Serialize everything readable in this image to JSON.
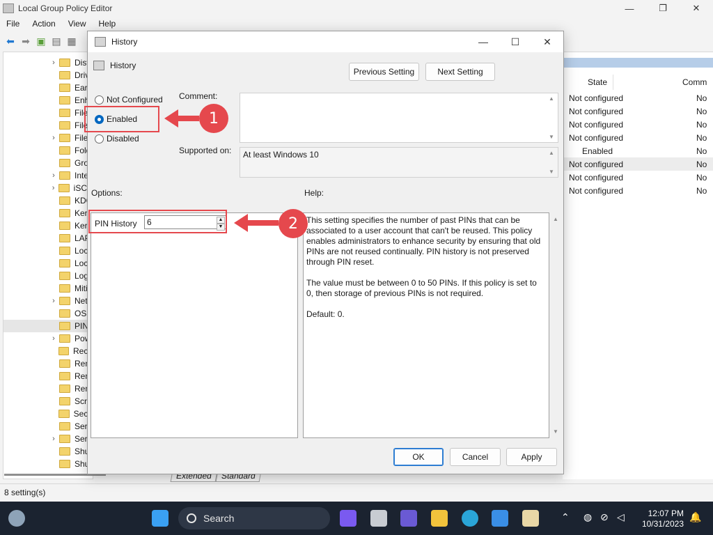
{
  "app": {
    "title": "Local Group Policy Editor",
    "window_controls": [
      "—",
      "❐",
      "✕"
    ],
    "menu": [
      "File",
      "Action",
      "View",
      "Help"
    ]
  },
  "tree": {
    "items": [
      {
        "label": "Dist",
        "expandable": true
      },
      {
        "label": "Driv",
        "expandable": false
      },
      {
        "label": "Earl",
        "expandable": false
      },
      {
        "label": "Enh",
        "expandable": false
      },
      {
        "label": "File",
        "expandable": false
      },
      {
        "label": "File",
        "expandable": false
      },
      {
        "label": "File",
        "expandable": true
      },
      {
        "label": "Fold",
        "expandable": false
      },
      {
        "label": "Gro",
        "expandable": false
      },
      {
        "label": "Inte",
        "expandable": true
      },
      {
        "label": "iSCS",
        "expandable": true
      },
      {
        "label": "KDC",
        "expandable": false
      },
      {
        "label": "Ker",
        "expandable": false
      },
      {
        "label": "Ker",
        "expandable": false
      },
      {
        "label": "LAP",
        "expandable": false
      },
      {
        "label": "Loc",
        "expandable": false
      },
      {
        "label": "Loc",
        "expandable": false
      },
      {
        "label": "Log",
        "expandable": false
      },
      {
        "label": "Miti",
        "expandable": false
      },
      {
        "label": "Net",
        "expandable": true
      },
      {
        "label": "OS I",
        "expandable": false
      },
      {
        "label": "PIN",
        "expandable": false,
        "selected": true
      },
      {
        "label": "Pow",
        "expandable": true
      },
      {
        "label": "Reco",
        "expandable": false
      },
      {
        "label": "Rem",
        "expandable": false
      },
      {
        "label": "Rem",
        "expandable": false
      },
      {
        "label": "Rem",
        "expandable": false
      },
      {
        "label": "Scri",
        "expandable": false
      },
      {
        "label": "Secu",
        "expandable": false
      },
      {
        "label": "Serv",
        "expandable": false
      },
      {
        "label": "Serv",
        "expandable": true
      },
      {
        "label": "Shu",
        "expandable": false
      },
      {
        "label": "Shu",
        "expandable": false
      }
    ]
  },
  "list": {
    "columns": {
      "state": "State",
      "comment": "Comm"
    },
    "rows": [
      {
        "state": "Not configured",
        "comment": "No"
      },
      {
        "state": "Not configured",
        "comment": "No"
      },
      {
        "state": "Not configured",
        "comment": "No"
      },
      {
        "state": "Not configured",
        "comment": "No"
      },
      {
        "state": "Enabled",
        "comment": "No"
      },
      {
        "state": "Not configured",
        "comment": "No",
        "highlighted": true
      },
      {
        "state": "Not configured",
        "comment": "No"
      },
      {
        "state": "Not configured",
        "comment": "No"
      }
    ]
  },
  "view_tabs": [
    "Extended",
    "Standard"
  ],
  "status": "8 setting(s)",
  "dialog": {
    "title": "History",
    "policy_name": "History",
    "previous_setting": "Previous Setting",
    "next_setting": "Next Setting",
    "radio": {
      "not_configured": "Not Configured",
      "enabled": "Enabled",
      "disabled": "Disabled",
      "selected": "enabled"
    },
    "comment_label": "Comment:",
    "comment_value": "",
    "supported_label": "Supported on:",
    "supported_value": "At least Windows 10",
    "options_label": "Options:",
    "help_label": "Help:",
    "pin_history_label": "PIN History",
    "pin_history_value": "6",
    "help_paragraphs": [
      "This setting specifies the number of past PINs that can be associated to a user account that can't be reused. This policy enables administrators to enhance security by ensuring that old PINs are not reused continually. PIN history is not preserved through PIN reset.",
      "The value must be between 0 to 50 PINs. If this policy is set to 0, then storage of previous PINs is not required.",
      "Default: 0."
    ],
    "ok": "OK",
    "cancel": "Cancel",
    "apply": "Apply"
  },
  "annotations": [
    "1",
    "2"
  ],
  "taskbar": {
    "search": "Search",
    "time": "12:07 PM",
    "date": "10/31/2023"
  },
  "colors": {
    "annotation": "#e5484d",
    "accent": "#0067c0",
    "taskbar": "#1b2330"
  }
}
